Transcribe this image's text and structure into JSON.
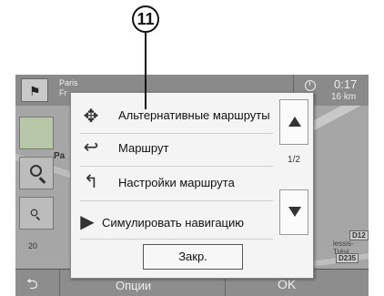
{
  "callout": {
    "label": "11"
  },
  "header": {
    "destination_city": "Paris",
    "destination_country": "Fr",
    "time": "0:17",
    "distance": "16 km"
  },
  "map_labels": {
    "district": "Pa",
    "zoom_20": "20",
    "road_d12": "D12",
    "road_d235": "D235",
    "place": "lessis-Trévi"
  },
  "popup": {
    "items": [
      {
        "label": "Альтернативные маршруты",
        "icon": "alternative-routes-icon"
      },
      {
        "label": "Маршрут",
        "icon": "route-icon"
      },
      {
        "label": "Настройки маршрута",
        "icon": "route-settings-icon"
      },
      {
        "label": "Симулировать навигацию",
        "icon": "play-icon"
      }
    ],
    "page_indicator": "1/2",
    "close_label": "Закр."
  },
  "footer": {
    "options_label": "Опции",
    "ok_label": "OK"
  },
  "colors": {
    "popup_bg": "#f4f4f4",
    "screen_bg": "#9a9a9a",
    "bar_bg": "#8a8a8a"
  }
}
